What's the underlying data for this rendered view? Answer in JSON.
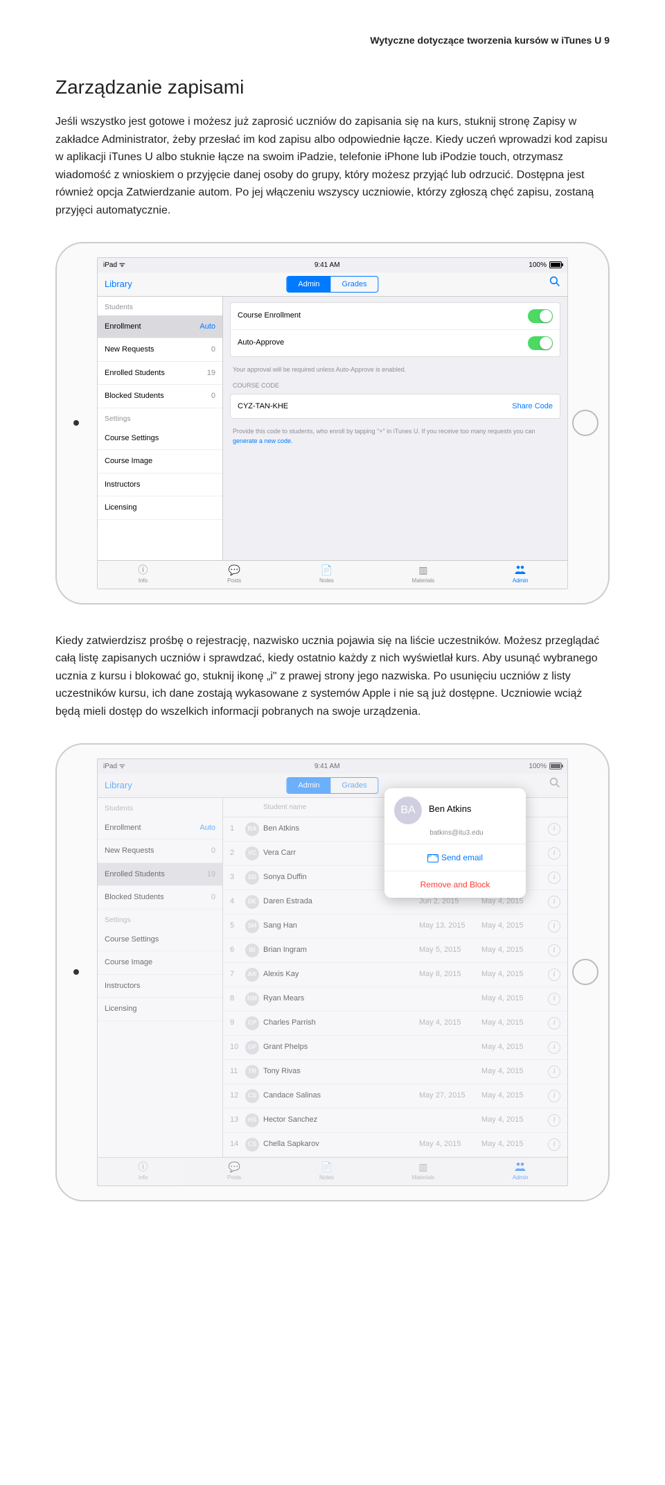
{
  "header": "Wytyczne dotyczące tworzenia kursów w iTunes U   9",
  "sectionTitle": "Zarządzanie zapisami",
  "para1": "Jeśli wszystko jest gotowe i możesz już zaprosić uczniów do zapisania się na kurs, stuknij stronę Zapisy w zakładce Administrator, żeby przesłać im kod zapisu albo odpowiednie łącze. Kiedy uczeń wprowadzi kod zapisu w aplikacji iTunes U albo stuknie łącze na swoim iPadzie, telefonie iPhone lub iPodzie touch, otrzymasz wiadomość z wnioskiem o przyjęcie danej osoby do grupy, który możesz przyjąć lub odrzucić. Dostępna jest również opcja Zatwierdzanie autom. Po jej włączeniu wszyscy uczniowie, którzy zgłoszą chęć zapisu, zostaną przyjęci automatycznie.",
  "para2": "Kiedy zatwierdzisz prośbę o rejestrację, nazwisko ucznia pojawia się na liście uczestników. Możesz przeglądać całą listę zapisanych uczniów i sprawdzać, kiedy ostatnio każdy z nich wyświetlał kurs. Aby usunąć wybranego ucznia z kursu i blokować go, stuknij ikonę „i\" z prawej strony jego nazwiska. Po usunięciu uczniów z listy uczestników kursu, ich dane zostają wykasowane z systemów Apple i nie są już dostępne. Uczniowie wciąż będą mieli dostęp do wszelkich informacji pobranych na swoje urządzenia.",
  "status": {
    "device": "iPad",
    "time": "9:41 AM",
    "batt": "100%"
  },
  "nav": {
    "back": "Library",
    "seg1": "Admin",
    "seg2": "Grades"
  },
  "sidebar": {
    "h1": "Students",
    "h2": "Settings",
    "enrollment": {
      "label": "Enrollment",
      "val": "Auto"
    },
    "newreq": {
      "label": "New Requests",
      "val": "0"
    },
    "enrolled": {
      "label": "Enrolled Students",
      "val": "19"
    },
    "blocked": {
      "label": "Blocked Students",
      "val": "0"
    },
    "cs": "Course Settings",
    "ci": "Course Image",
    "ins": "Instructors",
    "lic": "Licensing"
  },
  "content1": {
    "ce": "Course Enrollment",
    "aa": "Auto-Approve",
    "hint1": "Your approval will be required unless Auto-Approve is enabled.",
    "cap": "COURSE CODE",
    "code": "CYZ-TAN-KHE",
    "share": "Share Code",
    "hint2a": "Provide this code to students, who enroll by tapping \"+\" in iTunes U. If you receive too many requests you can ",
    "hint2b": "generate a new code."
  },
  "tabs": {
    "info": "Info",
    "posts": "Posts",
    "notes": "Notes",
    "materials": "Materials",
    "admin": "Admin"
  },
  "table": {
    "head": "Student name",
    "rows": [
      {
        "n": "1",
        "init": "BA",
        "name": "Ben Atkins",
        "d1": "",
        "d2": ""
      },
      {
        "n": "2",
        "init": "VC",
        "name": "Vera Carr",
        "d1": "",
        "d2": ""
      },
      {
        "n": "3",
        "init": "SD",
        "name": "Sonya Duffin",
        "d1": "",
        "d2": ""
      },
      {
        "n": "4",
        "init": "DE",
        "name": "Daren Estrada",
        "d1": "Jun 2, 2015",
        "d2": "May 4, 2015"
      },
      {
        "n": "5",
        "init": "SH",
        "name": "Sang Han",
        "d1": "May 13, 2015",
        "d2": "May 4, 2015"
      },
      {
        "n": "6",
        "init": "BI",
        "name": "Brian Ingram",
        "d1": "May 5, 2015",
        "d2": "May 4, 2015"
      },
      {
        "n": "7",
        "init": "AK",
        "name": "Alexis Kay",
        "d1": "May 8, 2015",
        "d2": "May 4, 2015"
      },
      {
        "n": "8",
        "init": "RM",
        "name": "Ryan Mears",
        "d1": "",
        "d2": "May 4, 2015"
      },
      {
        "n": "9",
        "init": "CP",
        "name": "Charles Parrish",
        "d1": "May 4, 2015",
        "d2": "May 4, 2015"
      },
      {
        "n": "10",
        "init": "GP",
        "name": "Grant Phelps",
        "d1": "",
        "d2": "May 4, 2015"
      },
      {
        "n": "11",
        "init": "TR",
        "name": "Tony Rivas",
        "d1": "",
        "d2": "May 4, 2015"
      },
      {
        "n": "12",
        "init": "CS",
        "name": "Candace Salinas",
        "d1": "May 27, 2015",
        "d2": "May 4, 2015"
      },
      {
        "n": "13",
        "init": "HS",
        "name": "Hector Sanchez",
        "d1": "",
        "d2": "May 4, 2015"
      },
      {
        "n": "14",
        "init": "CS",
        "name": "Chella Sapkarov",
        "d1": "May 4, 2015",
        "d2": "May 4, 2015"
      }
    ]
  },
  "popover": {
    "init": "BA",
    "name": "Ben Atkins",
    "email": "batkins@itu3.edu",
    "send": "Send email",
    "remove": "Remove and Block"
  }
}
